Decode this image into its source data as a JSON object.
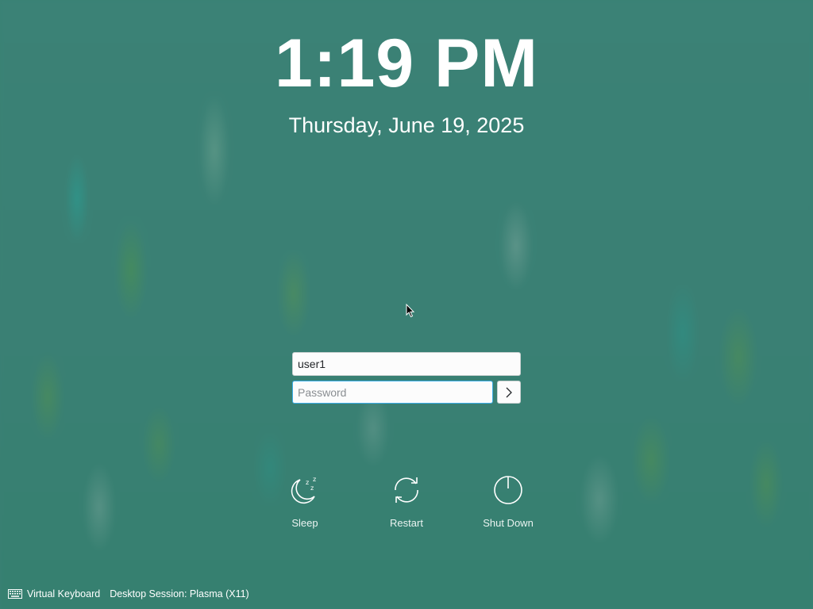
{
  "clock": {
    "time": "1:19 PM",
    "date": "Thursday, June 19, 2025"
  },
  "login": {
    "username_value": "user1",
    "password_placeholder": "Password",
    "submit_icon": "chevron-right-icon"
  },
  "actions": [
    {
      "label": "Sleep",
      "icon": "sleep-icon"
    },
    {
      "label": "Restart",
      "icon": "restart-icon"
    },
    {
      "label": "Shut Down",
      "icon": "power-icon"
    }
  ],
  "footer": {
    "virtual_keyboard": "Virtual Keyboard",
    "session": "Desktop Session: Plasma (X11)"
  },
  "colors": {
    "background": "#3a8275",
    "text": "#ffffff",
    "field_focus": "#3daee9"
  }
}
